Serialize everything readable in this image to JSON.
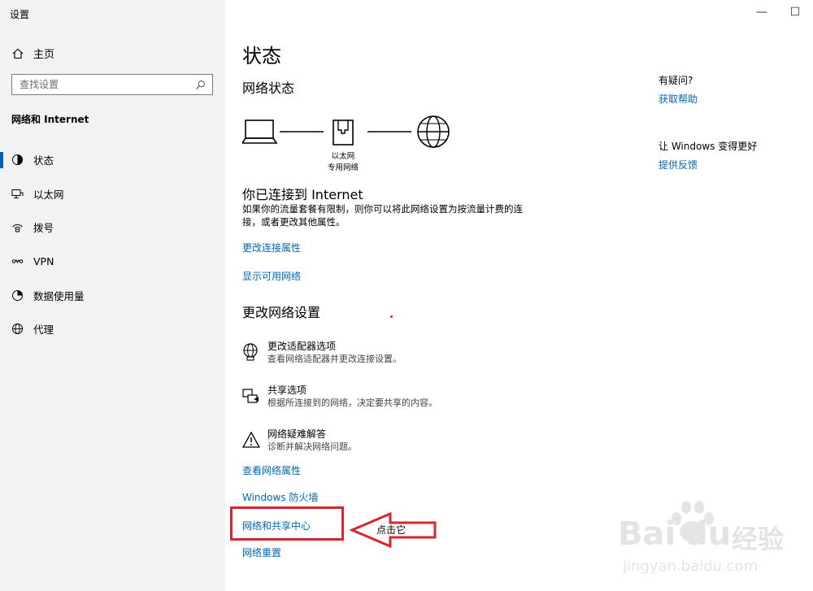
{
  "window": {
    "title": "设置",
    "minimize": "—",
    "maximize": "☐"
  },
  "sidebar": {
    "home_label": "主页",
    "search_placeholder": "查找设置",
    "section_title": "网络和 Internet",
    "items": [
      {
        "label": "状态",
        "icon": "status-icon",
        "active": true
      },
      {
        "label": "以太网",
        "icon": "ethernet-icon"
      },
      {
        "label": "拨号",
        "icon": "dialup-icon"
      },
      {
        "label": "VPN",
        "icon": "vpn-icon"
      },
      {
        "label": "数据使用量",
        "icon": "data-usage-icon"
      },
      {
        "label": "代理",
        "icon": "globe-icon"
      }
    ]
  },
  "main": {
    "title": "状态",
    "network_status_heading": "网络状态",
    "diagram": {
      "adapter_name": "以太网",
      "network_type": "专用网络"
    },
    "connected_heading": "你已连接到 Internet",
    "connected_desc": "如果你的流量套餐有限制，则你可以将此网络设置为按流量计费的连接，或者更改其他属性。",
    "link_change_props": "更改连接属性",
    "link_show_networks": "显示可用网络",
    "change_settings_heading": "更改网络设置",
    "options": [
      {
        "title": "更改适配器选项",
        "desc": "查看网络适配器并更改连接设置。",
        "icon": "adapter-globe-icon"
      },
      {
        "title": "共享选项",
        "desc": "根据所连接到的网络，决定要共享的内容。",
        "icon": "sharing-icon"
      },
      {
        "title": "网络疑难解答",
        "desc": "诊断并解决网络问题。",
        "icon": "warning-icon"
      }
    ],
    "link_view_props": "查看网络属性",
    "link_firewall": "Windows 防火墙",
    "link_sharing_center": "网络和共享中心",
    "link_reset": "网络重置"
  },
  "annotation": {
    "arrow_label": "点击它",
    "color": "#d9262c"
  },
  "aside": {
    "question": "有疑问?",
    "help_link": "获取帮助",
    "improve": "让 Windows 变得更好",
    "feedback_link": "提供反馈"
  },
  "watermark": {
    "brand": "Bai",
    "brand2": "du",
    "cn": "经验",
    "url": "jingyan.baidu.com"
  },
  "colors": {
    "accent": "#0063b1",
    "link": "#0067b8",
    "sidebar_bg": "#f2f2f2"
  }
}
